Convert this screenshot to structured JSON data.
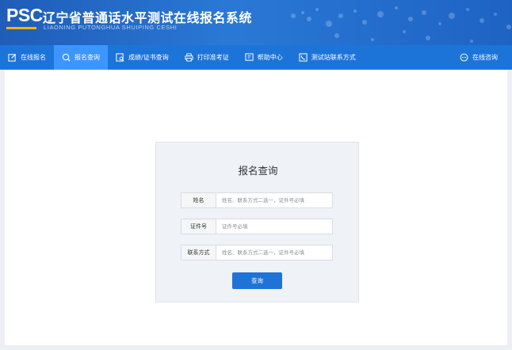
{
  "header": {
    "logo": "PSC",
    "title": "辽宁省普通话水平测试在线报名系统",
    "subtitle": "LIAONING PUTONGHUA SHUIPING CESHI"
  },
  "nav": {
    "items": [
      {
        "label": "在线报名",
        "icon": "edit-icon"
      },
      {
        "label": "报名查询",
        "icon": "search-icon",
        "active": true
      },
      {
        "label": "成绩/证书查询",
        "icon": "certificate-search-icon"
      },
      {
        "label": "打印准考证",
        "icon": "printer-icon"
      },
      {
        "label": "帮助中心",
        "icon": "help-icon"
      },
      {
        "label": "测试站联系方式",
        "icon": "contact-icon"
      }
    ],
    "right": {
      "label": "在线咨询",
      "icon": "chat-icon"
    }
  },
  "query": {
    "title": "报名查询",
    "fields": [
      {
        "label": "姓名",
        "value": "",
        "placeholder": "姓名、联系方式二选一，证件号必填"
      },
      {
        "label": "证件号",
        "value": "",
        "placeholder": "证件号必填"
      },
      {
        "label": "联系方式",
        "value": "",
        "placeholder": "姓名、联系方式二选一，证件号必填"
      }
    ],
    "button": "查询"
  },
  "colors": {
    "nav_bg": "#1d74d8",
    "nav_active": "#3d96ff",
    "button": "#1f73d6",
    "logo_accent": "#f5b400"
  }
}
